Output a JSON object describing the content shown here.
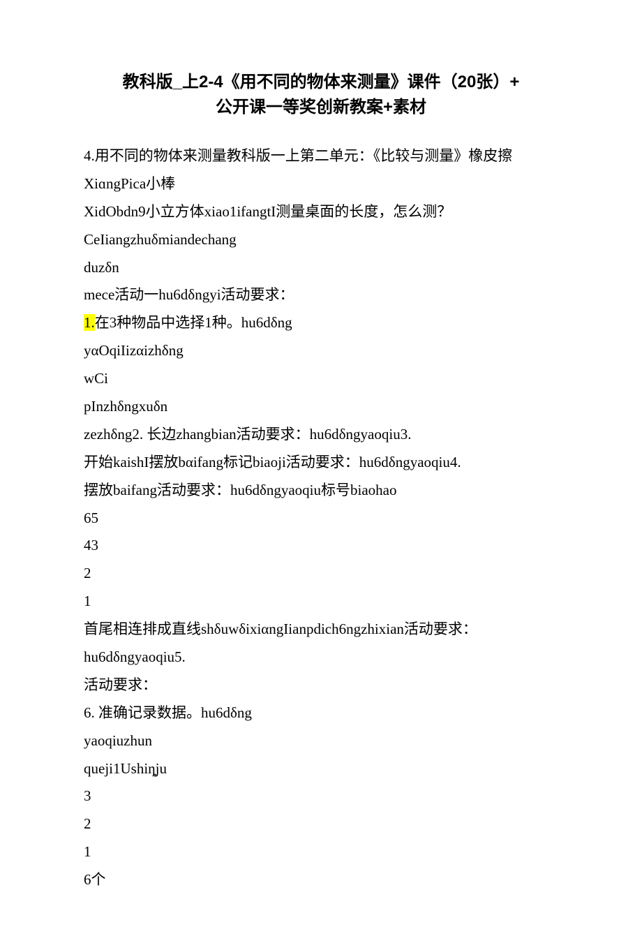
{
  "title": {
    "line1": "教科版_上2-4《用不同的物体来测量》课件（20张）+",
    "line2": "公开课一等奖创新教案+素材"
  },
  "lines": [
    "4.用不同的物体来测量教科版一上第二单元：《比较与测量》橡皮擦",
    "XiɑngPica小棒",
    "XidObdn9小立方体xiao1ifangtI测量桌面的长度，怎么测？",
    "CeIiangzhuδmiandechang",
    "duzδn",
    "mece活动一hu6dδngyi活动要求：",
    {
      "highlight": "1.",
      "rest": "在3种物品中选择1种。hu6dδng"
    },
    "yαOqiIizαizhδng",
    "wCi",
    "pInzhδngxuδn",
    "zezhδng2. 长边zhangbian活动要求：hu6dδngyaoqiu3.",
    "开始kaishI摆放bαifang标记biaoji活动要求：hu6dδngyaoqiu4.",
    "摆放baifang活动要求：hu6dδngyaoqiu标号biaohao",
    "65",
    "43",
    "2",
    "1",
    "首尾相连排成直线shδuwδixiαngIianpdich6ngzhixian活动要求：",
    "hu6dδngyaoqiu5.",
    "活动要求：",
    "6. 准确记录数据。hu6dδng",
    "yaoqiuzhun",
    "queji1Ushiȵju",
    "3",
    "2",
    "1",
    "6个"
  ]
}
